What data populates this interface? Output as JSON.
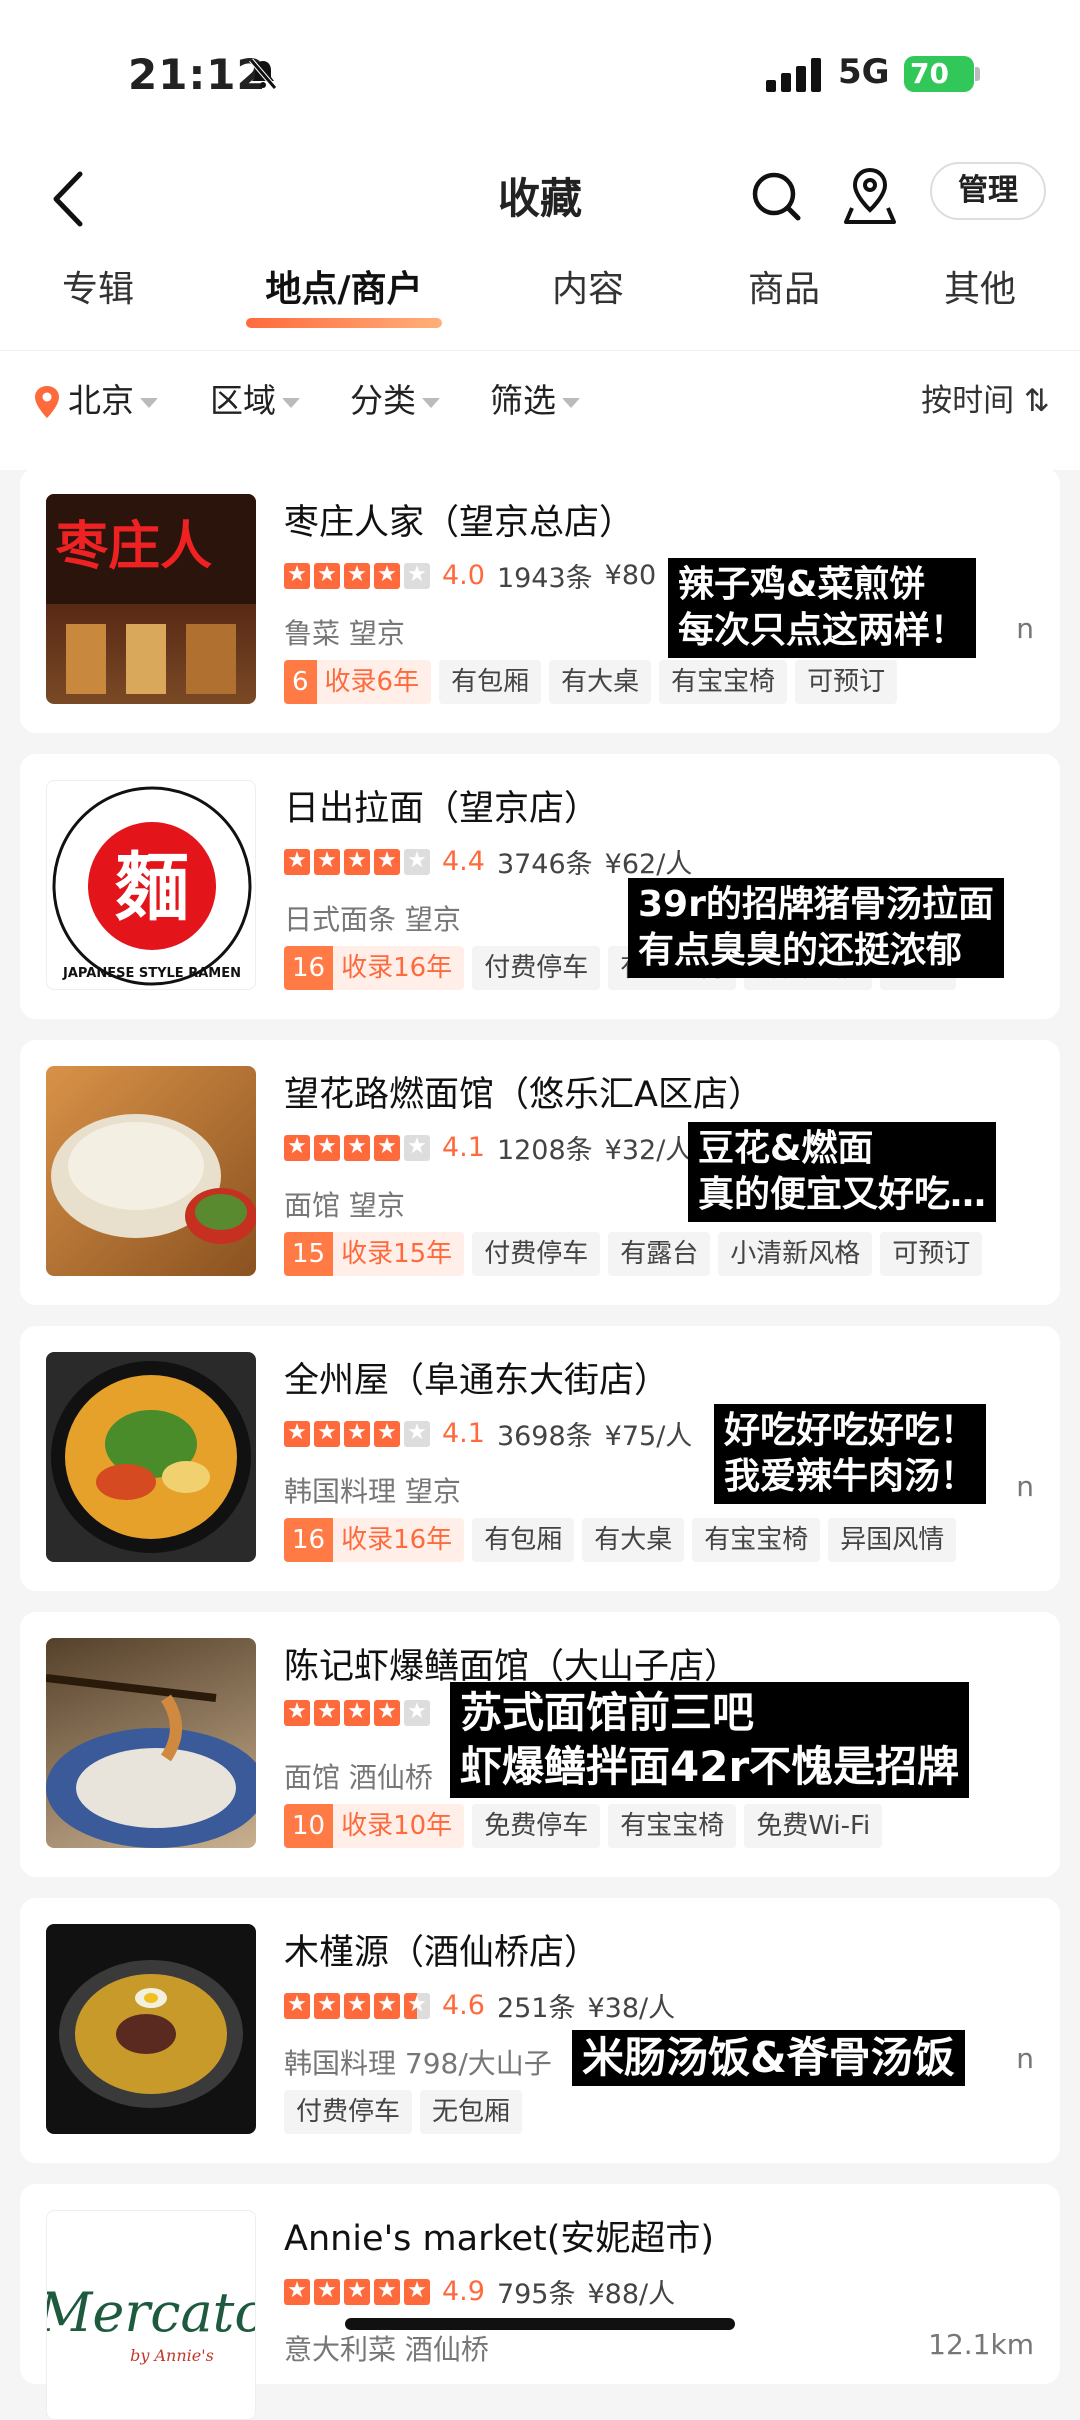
{
  "status": {
    "time": "21:12",
    "network": "5G",
    "battery": "70"
  },
  "nav": {
    "title": "收藏",
    "manage": "管理"
  },
  "tabs": [
    "专辑",
    "地点/商户",
    "内容",
    "商品",
    "其他"
  ],
  "filters": {
    "city": "北京",
    "area": "区域",
    "category": "分类",
    "filter": "筛选",
    "sort": "按时间 ⇅"
  },
  "colors": {
    "accent": "#ff6a3d",
    "rec_badge": "#ff7a45"
  },
  "cards": [
    {
      "name": "枣庄人家（望京总店）",
      "score": "4.0",
      "stars": [
        1,
        1,
        1,
        1,
        0
      ],
      "reviews": "1943条",
      "price": "¥80",
      "sub": "鲁菜 望京",
      "dist": "n",
      "rec_num": "6",
      "rec_text": "收录6年",
      "tags": [
        "有包厢",
        "有大桌",
        "有宝宝椅",
        "可预订"
      ],
      "note": [
        "辣子鸡&菜煎饼",
        "每次只点这两样！"
      ],
      "icon": "restaurant-sign-image"
    },
    {
      "name": "日出拉面（望京店）",
      "score": "4.4",
      "stars": [
        1,
        1,
        1,
        1,
        0
      ],
      "reviews": "3746条",
      "price": "¥62/人",
      "sub": "日式面条 望京",
      "dist": "",
      "rec_num": "16",
      "rec_text": "收录16年",
      "tags": [
        "付费停车",
        "有宝宝椅",
        "异国风情",
        "免预"
      ],
      "note": [
        "39r的招牌猪骨汤拉面",
        "有点臭臭的还挺浓郁"
      ],
      "logo_char": "麵",
      "logo_text": "JAPANESE STYLE RAMEN",
      "icon": "ramen-logo"
    },
    {
      "name": "望花路燃面馆（悠乐汇A区店）",
      "score": "4.1",
      "stars": [
        1,
        1,
        1,
        1,
        0
      ],
      "reviews": "1208条",
      "price": "¥32/人",
      "sub": "面馆 望京",
      "dist": "",
      "rec_num": "15",
      "rec_text": "收录15年",
      "tags": [
        "付费停车",
        "有露台",
        "小清新风格",
        "可预订"
      ],
      "note": [
        "豆花&燃面",
        "真的便宜又好吃…"
      ],
      "icon": "tofu-bowl-image"
    },
    {
      "name": "全州屋（阜通东大街店）",
      "score": "4.1",
      "stars": [
        1,
        1,
        1,
        1,
        0
      ],
      "reviews": "3698条",
      "price": "¥75/人",
      "sub": "韩国料理 望京",
      "dist": "n",
      "rec_num": "16",
      "rec_text": "收录16年",
      "tags": [
        "有包厢",
        "有大桌",
        "有宝宝椅",
        "异国风情"
      ],
      "note": [
        "好吃好吃好吃！",
        "我爱辣牛肉汤！"
      ],
      "icon": "korean-soup-image"
    },
    {
      "name": "陈记虾爆鳝面馆（大山子店）",
      "score": "",
      "stars": [
        1,
        1,
        1,
        1,
        0
      ],
      "reviews": "",
      "price": "",
      "sub": "面馆 酒仙桥",
      "dist": "",
      "rec_num": "10",
      "rec_text": "收录10年",
      "tags": [
        "免费停车",
        "有宝宝椅",
        "免费Wi-Fi"
      ],
      "note": [
        "苏式面馆前三吧",
        "虾爆鳝拌面42r不愧是招牌"
      ],
      "icon": "noodle-chopsticks-image"
    },
    {
      "name": "木槿源（酒仙桥店）",
      "score": "4.6",
      "stars": [
        1,
        1,
        1,
        1,
        0.5
      ],
      "reviews": "251条",
      "price": "¥38/人",
      "sub": "韩国料理 798/大山子",
      "dist": "n",
      "rec_num": "",
      "rec_text": "",
      "tags": [
        "付费停车",
        "无包厢"
      ],
      "note": [
        "米肠汤饭&脊骨汤饭"
      ],
      "icon": "cold-noodle-image"
    },
    {
      "name": "Annie's market(安妮超市)",
      "score": "4.9",
      "stars": [
        1,
        1,
        1,
        1,
        1
      ],
      "reviews": "795条",
      "price": "¥88/人",
      "sub": "意大利菜 酒仙桥",
      "dist": "12.1km",
      "rec_num": "",
      "rec_text": "",
      "tags": [],
      "note": [],
      "logo_main": "Mercato",
      "logo_sub": "by Annie's",
      "icon": "mercato-logo"
    }
  ]
}
